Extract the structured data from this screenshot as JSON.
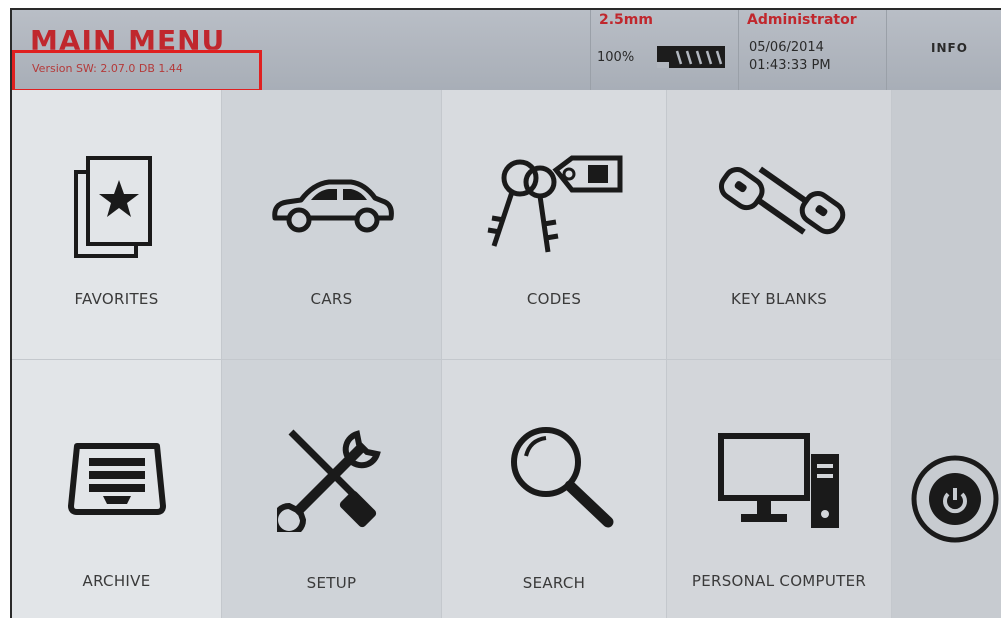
{
  "header": {
    "title": "MAIN MENU",
    "version": "Version SW: 2.07.0 DB 1.44",
    "cut_size": "2.5mm",
    "percent": "100%",
    "user": "Administrator",
    "date": "05/06/2014",
    "time": "01:43:33 PM",
    "info_label": "INFO"
  },
  "tiles": [
    {
      "label": "FAVORITES",
      "icon": "favorites-icon"
    },
    {
      "label": "CARS",
      "icon": "car-icon"
    },
    {
      "label": "CODES",
      "icon": "keys-tag-icon"
    },
    {
      "label": "KEY BLANKS",
      "icon": "key-blanks-icon"
    },
    {
      "label": "ARCHIVE",
      "icon": "archive-tray-icon"
    },
    {
      "label": "SETUP",
      "icon": "tools-icon"
    },
    {
      "label": "SEARCH",
      "icon": "magnifier-icon"
    },
    {
      "label": "PERSONAL COMPUTER",
      "icon": "computer-icon"
    }
  ],
  "colors": {
    "accent_red": "#c0272d",
    "highlight_box": "#e02020",
    "header_bg": "#b0b6be"
  }
}
